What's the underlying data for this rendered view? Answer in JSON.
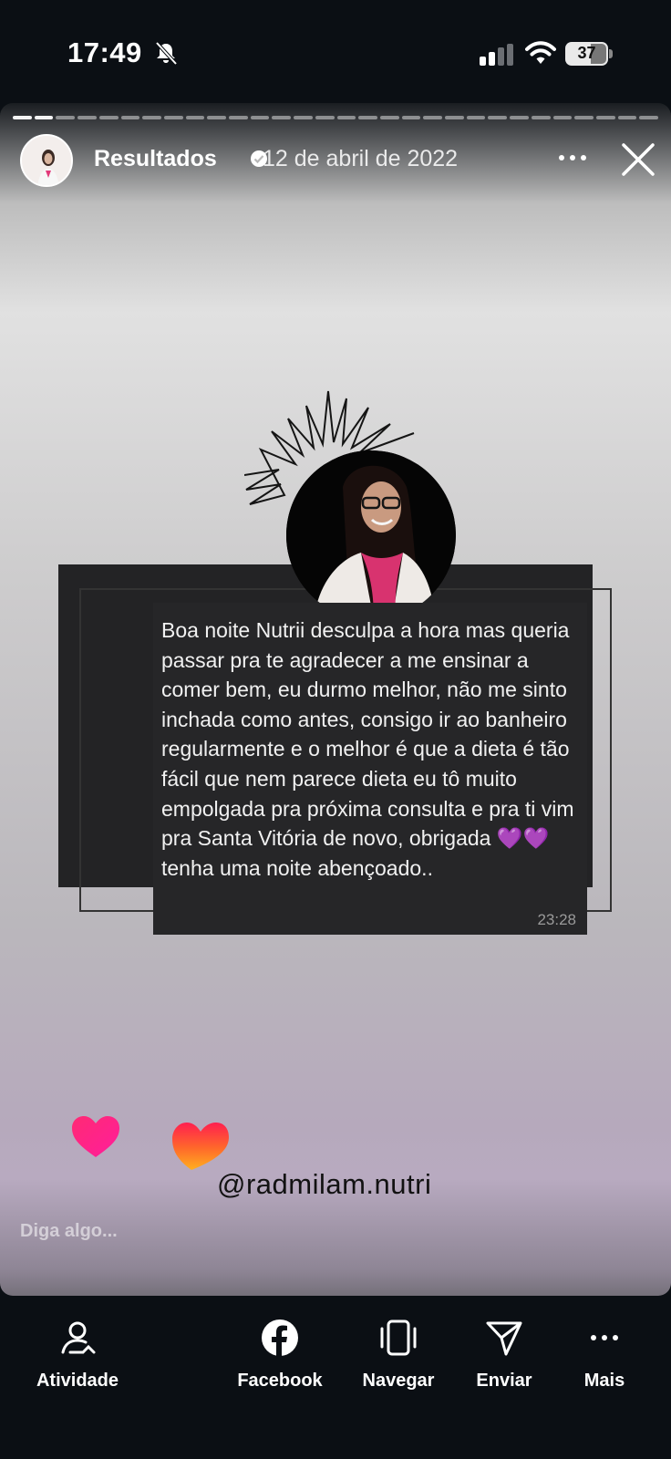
{
  "status_bar": {
    "time": "17:49",
    "battery": "37"
  },
  "story": {
    "author": "Resultados",
    "date": "12 de abril de 2022",
    "message": "Boa noite Nutrii desculpa a hora mas queria passar pra te agradecer a me ensinar a comer bem, eu durmo melhor, não me sinto inchada como antes, consigo ir ao banheiro regularmente e o melhor é que a dieta é tão fácil que nem parece dieta eu tô muito empolgada pra próxima consulta e pra ti vim pra Santa Vitória de novo, obrigada 💜💜 tenha uma noite abençoado..",
    "message_time": "23:28",
    "handle": "@radmilam.nutri",
    "reply_placeholder": "Diga algo..."
  },
  "nav": {
    "activity": "Atividade",
    "facebook": "Facebook",
    "browse": "Navegar",
    "send": "Enviar",
    "more": "Mais"
  },
  "colors": {
    "background": "#0b0f14",
    "message_bubble": "#262628",
    "heart_purple": "#9a4cf0"
  },
  "icons": [
    "mute-icon",
    "signal-icon",
    "wifi-icon",
    "battery-icon",
    "verified-icon",
    "more-icon",
    "close-icon",
    "activity-icon",
    "facebook-icon",
    "browse-icon",
    "send-icon",
    "more-dots-icon"
  ]
}
